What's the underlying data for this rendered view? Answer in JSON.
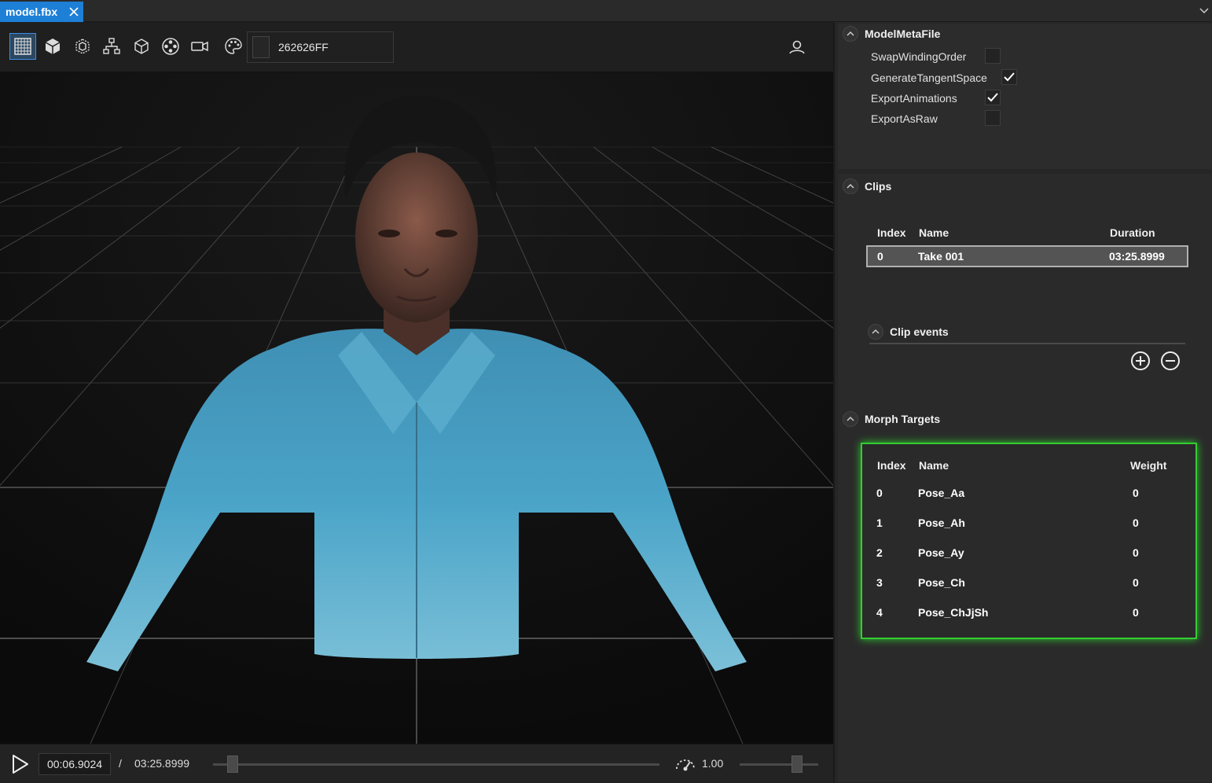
{
  "tab": {
    "label": "model.fbx"
  },
  "toolbar": {
    "color_value": "262626FF",
    "tools": [
      "grid-icon",
      "cube-solid-icon",
      "cube-dots-icon",
      "hierarchy-icon",
      "cube-wire-icon",
      "skeleton-icon",
      "camera-icon",
      "palette-icon"
    ]
  },
  "timeline": {
    "current_time": "00:06.9024",
    "separator": "/",
    "total_time": "03:25.8999",
    "speed": "1.00",
    "progress": 0.034,
    "speed_level": 0.73
  },
  "model_meta": {
    "title": "ModelMetaFile",
    "props": [
      {
        "label": "SwapWindingOrder",
        "checked": false
      },
      {
        "label": "GenerateTangentSpace",
        "checked": true
      },
      {
        "label": "ExportAnimations",
        "checked": true
      },
      {
        "label": "ExportAsRaw",
        "checked": false
      }
    ]
  },
  "clips": {
    "title": "Clips",
    "headers": {
      "index": "Index",
      "name": "Name",
      "duration": "Duration"
    },
    "rows": [
      {
        "index": "0",
        "name": "Take 001",
        "duration": "03:25.8999"
      }
    ],
    "events_title": "Clip events"
  },
  "morph": {
    "title": "Morph Targets",
    "headers": {
      "index": "Index",
      "name": "Name",
      "weight": "Weight"
    },
    "rows": [
      {
        "index": "0",
        "name": "Pose_Aa",
        "weight": "0"
      },
      {
        "index": "1",
        "name": "Pose_Ah",
        "weight": "0"
      },
      {
        "index": "2",
        "name": "Pose_Ay",
        "weight": "0"
      },
      {
        "index": "3",
        "name": "Pose_Ch",
        "weight": "0"
      },
      {
        "index": "4",
        "name": "Pose_ChJjSh",
        "weight": "0"
      }
    ]
  },
  "colors": {
    "accent": "#1d7fd6",
    "highlight": "#33cc33",
    "shirt": "#4a9fc2"
  }
}
